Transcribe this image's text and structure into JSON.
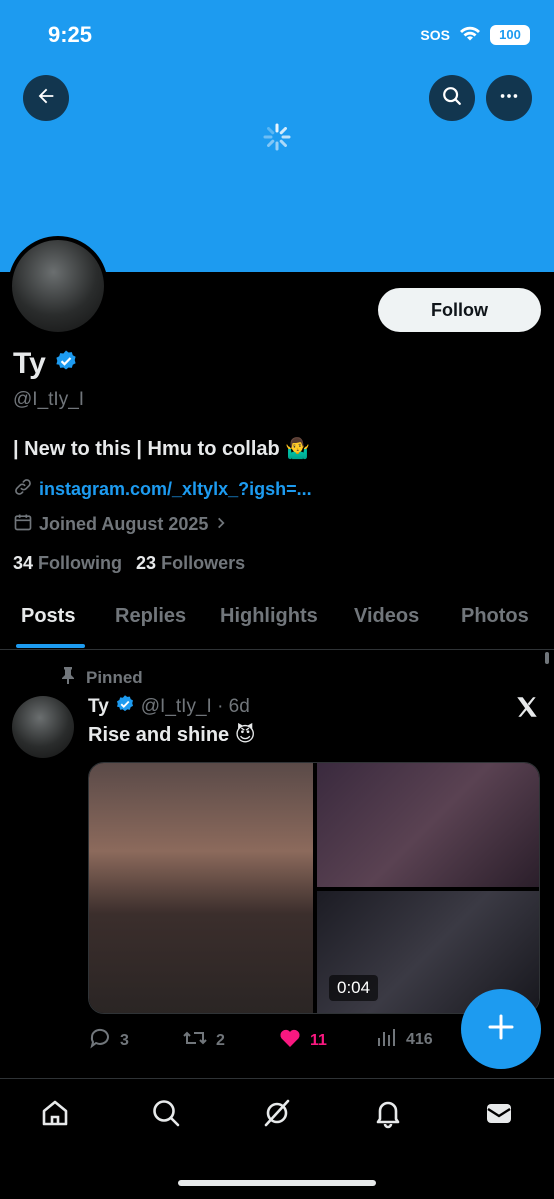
{
  "status_bar": {
    "time": "9:25",
    "sos": "SOS",
    "battery": "100"
  },
  "profile": {
    "name": "Ty",
    "handle": "@I_tIy_I",
    "bio": "| New to this | Hmu to collab 🤷‍♂️",
    "link": "instagram.com/_xltylx_?igsh=...",
    "joined": "Joined August 2025",
    "following_count": "34",
    "following_label": "Following",
    "followers_count": "23",
    "followers_label": "Followers",
    "follow_label": "Follow"
  },
  "tabs": [
    {
      "label": "Posts"
    },
    {
      "label": "Replies"
    },
    {
      "label": "Highlights"
    },
    {
      "label": "Videos"
    },
    {
      "label": "Photos"
    }
  ],
  "tweet": {
    "pinned_label": "Pinned",
    "author": "Ty",
    "handle_time": "@I_tIy_I · 6d",
    "text": "Rise and shine 😈",
    "video_duration": "0:04",
    "replies": "3",
    "reposts": "2",
    "likes": "11",
    "views": "416"
  },
  "colors": {
    "accent": "#1d9bf0",
    "like": "#f91880",
    "background": "#000000"
  },
  "icons": [
    "back-arrow-icon",
    "search-icon",
    "more-icon",
    "verified-badge-icon",
    "link-icon",
    "calendar-icon",
    "pin-icon",
    "x-logo-icon",
    "reply-icon",
    "repost-icon",
    "like-icon",
    "views-icon",
    "compose-icon",
    "home-icon",
    "explore-icon",
    "grok-icon",
    "notifications-icon",
    "messages-icon"
  ]
}
